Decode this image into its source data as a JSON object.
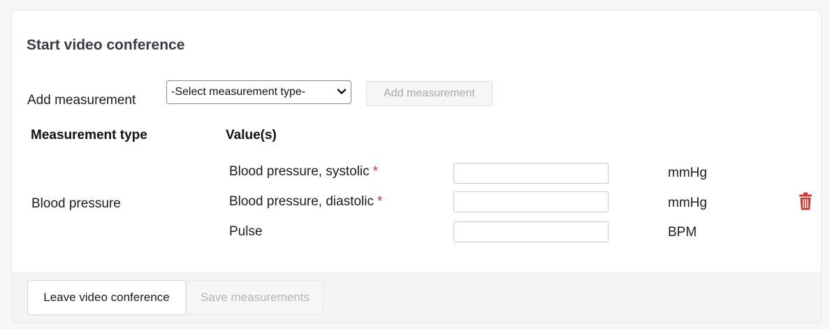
{
  "card": {
    "title": "Start video conference"
  },
  "add_measurement": {
    "label": "Add measurement",
    "select_value": "-Select measurement type-",
    "button_label": "Add measurement"
  },
  "table": {
    "headers": [
      "Measurement type",
      "Value(s)"
    ],
    "rows": [
      {
        "type": "Blood pressure",
        "values": [
          {
            "label": "Blood pressure, systolic",
            "required_marker": "*",
            "value": "",
            "unit": "mmHg"
          },
          {
            "label": "Blood pressure, diastolic",
            "required_marker": "*",
            "value": "",
            "unit": "mmHg"
          },
          {
            "label": "Pulse",
            "value": "",
            "unit": "BPM"
          }
        ],
        "delete_icon": "trash-icon"
      }
    ]
  },
  "footer": {
    "leave_label": "Leave video conference",
    "save_label": "Save measurements"
  },
  "colors": {
    "required": "#d9342b",
    "delete_icon": "#d9342b",
    "disabled_text": "#a9a9a9"
  }
}
